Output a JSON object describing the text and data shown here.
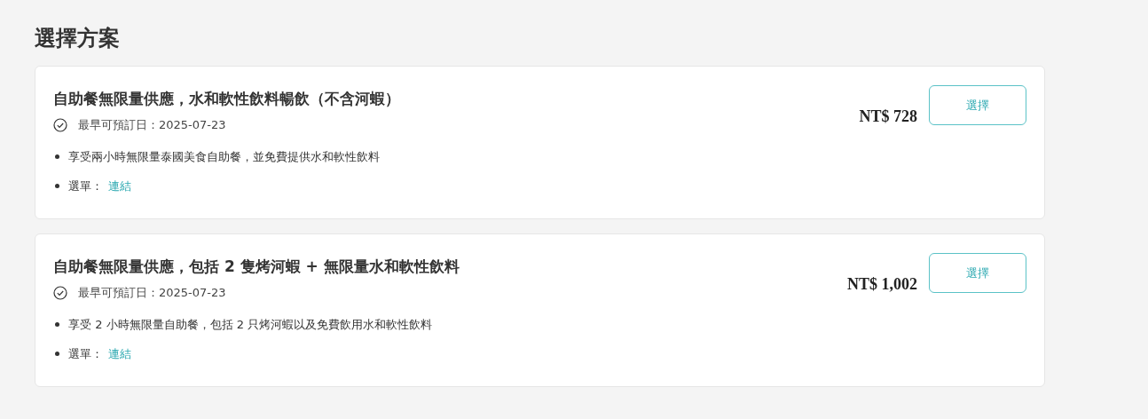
{
  "heading": "選擇方案",
  "plans": [
    {
      "title": "自助餐無限量供應，水和軟性飲料暢飲（不含河蝦）",
      "availability": "最早可預訂日：2025-07-23",
      "details": [
        {
          "kind": "text",
          "text": "享受兩小時無限量泰國美食自助餐，並免費提供水和軟性飲料"
        },
        {
          "kind": "link",
          "label": "選單：",
          "link": "連結"
        }
      ],
      "price": "NT$ 728",
      "button": "選擇"
    },
    {
      "title": "自助餐無限量供應，包括 2 隻烤河蝦 + 無限量水和軟性飲料",
      "availability": "最早可預訂日：2025-07-23",
      "details": [
        {
          "kind": "text",
          "text": "享受 2 小時無限量自助餐，包括 2 只烤河蝦以及免費飲用水和軟性飲料"
        },
        {
          "kind": "link",
          "label": "選單：",
          "link": "連結"
        }
      ],
      "price": "NT$ 1,002",
      "button": "選擇"
    }
  ]
}
